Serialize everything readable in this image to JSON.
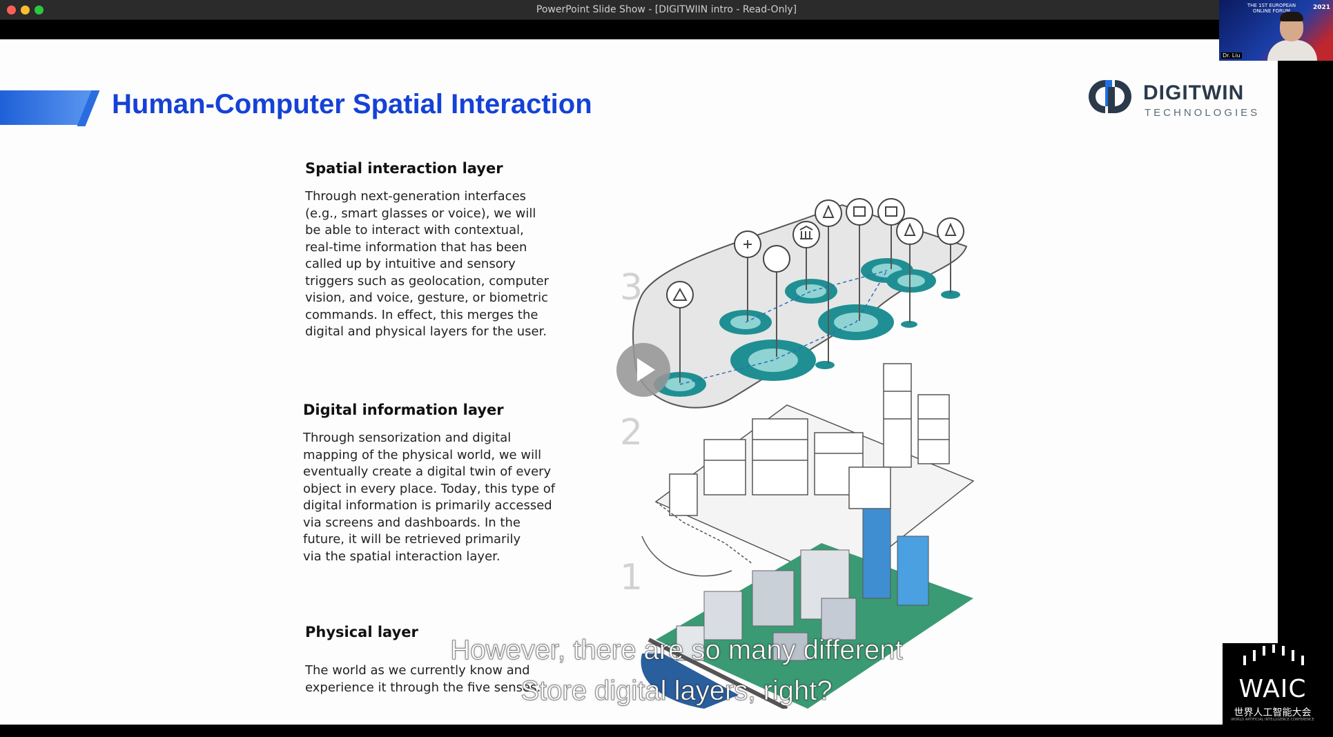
{
  "window": {
    "title": "PowerPoint Slide Show - [DIGITWIIN intro  -  Read-Only]"
  },
  "slide": {
    "title": "Human-Computer Spatial Interaction",
    "logo": {
      "name": "DIGITWIN",
      "subtitle": "TECHNOLOGIES"
    },
    "layers": [
      {
        "number": "3",
        "heading": "Spatial interaction layer",
        "lines": [
          "Through next-generation interfaces",
          "(e.g., smart glasses or voice), we will",
          "be able to interact with contextual,",
          "real-time information that has been",
          "called up by intuitive and sensory",
          "triggers such as geolocation, computer",
          "vision, and voice, gesture, or biometric",
          "commands. In effect, this merges the",
          "digital and physical layers for the user."
        ]
      },
      {
        "number": "2",
        "heading": "Digital information layer",
        "lines": [
          "Through sensorization and digital",
          "mapping of the physical world, we will",
          "eventually create a digital twin of every",
          "object in every place. Today, this type of",
          "digital information is primarily accessed",
          "via screens and dashboards. In the",
          "future, it will be retrieved primarily",
          "via the spatial interaction layer."
        ]
      },
      {
        "number": "1",
        "heading": "Physical layer",
        "lines": [
          "The world as we currently know and",
          "experience it through the five senses."
        ]
      }
    ]
  },
  "subtitles": {
    "line1": "However, there are so many different",
    "line2": "Store digital layers, right?"
  },
  "webcam": {
    "event_text": "THE 1ST EUROPEAN ONLINE FORUM",
    "year": "2021",
    "name_tag": "Dr. Liu"
  },
  "waic": {
    "logo_text": "WAIC",
    "chinese": "世界人工智能大会",
    "english": "WORLD ARTIFICIAL INTELLIGENCE CONFERENCE"
  },
  "colors": {
    "title_blue": "#1542d6",
    "teal": "#1f8f93",
    "slide_bg": "#fdfdfd"
  },
  "icons": [
    "play-icon",
    "sailboat-icon",
    "hospital-icon",
    "stadium-icon",
    "museum-icon",
    "tree-icon",
    "building-icon"
  ]
}
